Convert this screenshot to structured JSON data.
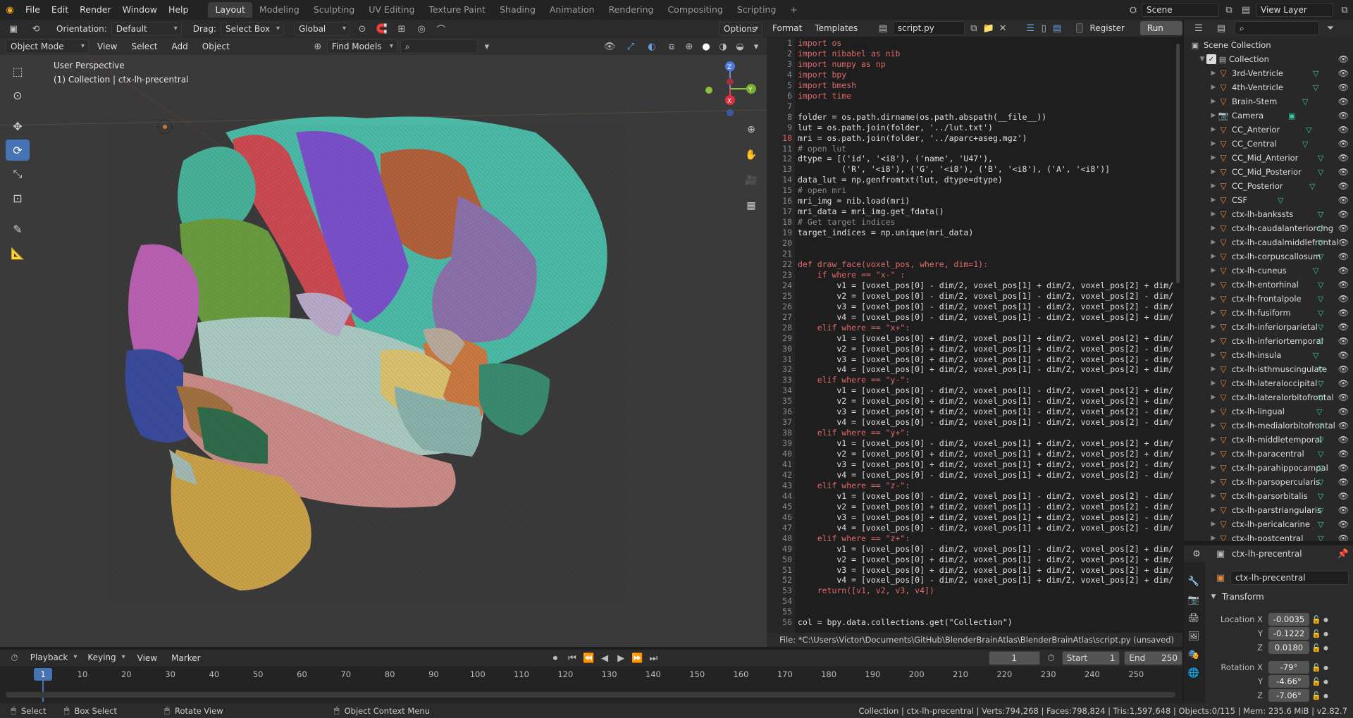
{
  "topbar": {
    "menus": [
      "File",
      "Edit",
      "Render",
      "Window",
      "Help"
    ],
    "workspaces": [
      "Layout",
      "Modeling",
      "Sculpting",
      "UV Editing",
      "Texture Paint",
      "Shading",
      "Animation",
      "Rendering",
      "Compositing",
      "Scripting"
    ],
    "active_workspace": "Layout",
    "scene": "Scene",
    "view_layer": "View Layer"
  },
  "viewport_header": {
    "orientation_label": "Orientation:",
    "orientation_value": "Default",
    "drag_label": "Drag:",
    "drag_value": "Select Box",
    "transform_space": "Global",
    "options": "Options"
  },
  "viewport_header2": {
    "mode": "Object Mode",
    "menus": [
      "View",
      "Select",
      "Add",
      "Object"
    ],
    "find_models": "Find Models"
  },
  "viewport": {
    "perspective": "User Perspective",
    "collection_info": "(1) Collection | ctx-lh-precentral",
    "gizmo_axes": [
      "Z",
      "Y",
      "X"
    ]
  },
  "editor_header": {
    "menus": [
      "Format",
      "Templates"
    ],
    "filename": "script.py",
    "register": "Register",
    "run": "Run Script"
  },
  "code_lines": [
    "import os",
    "import nibabel as nib",
    "import numpy as np",
    "import bpy",
    "import bmesh",
    "import time",
    "",
    "folder = os.path.dirname(os.path.abspath(__file__))",
    "lut = os.path.join(folder, '../lut.txt')",
    "mri = os.path.join(folder, '../aparc+aseg.mgz')",
    "# open lut",
    "dtype = [('id', '<i8'), ('name', 'U47'),",
    "         ('R', '<i8'), ('G', '<i8'), ('B', '<i8'), ('A', '<i8')]",
    "data_lut = np.genfromtxt(lut, dtype=dtype)",
    "# open mri",
    "mri_img = nib.load(mri)",
    "mri_data = mri_img.get_fdata()",
    "# Get target indices",
    "target_indices = np.unique(mri_data)",
    "",
    "",
    "def draw_face(voxel_pos, where, dim=1):",
    "    if where == \"x-\" :",
    "        v1 = [voxel_pos[0] - dim/2, voxel_pos[1] + dim/2, voxel_pos[2] + dim/",
    "        v2 = [voxel_pos[0] - dim/2, voxel_pos[1] - dim/2, voxel_pos[2] - dim/",
    "        v3 = [voxel_pos[0] - dim/2, voxel_pos[1] - dim/2, voxel_pos[2] - dim/",
    "        v4 = [voxel_pos[0] - dim/2, voxel_pos[1] - dim/2, voxel_pos[2] + dim/",
    "    elif where == \"x+\":",
    "        v1 = [voxel_pos[0] + dim/2, voxel_pos[1] + dim/2, voxel_pos[2] + dim/",
    "        v2 = [voxel_pos[0] + dim/2, voxel_pos[1] + dim/2, voxel_pos[2] - dim/",
    "        v3 = [voxel_pos[0] + dim/2, voxel_pos[1] - dim/2, voxel_pos[2] - dim/",
    "        v4 = [voxel_pos[0] + dim/2, voxel_pos[1] - dim/2, voxel_pos[2] + dim/",
    "    elif where == \"y-\":",
    "        v1 = [voxel_pos[0] - dim/2, voxel_pos[1] - dim/2, voxel_pos[2] + dim/",
    "        v2 = [voxel_pos[0] + dim/2, voxel_pos[1] - dim/2, voxel_pos[2] + dim/",
    "        v3 = [voxel_pos[0] + dim/2, voxel_pos[1] - dim/2, voxel_pos[2] - dim/",
    "        v4 = [voxel_pos[0] - dim/2, voxel_pos[1] - dim/2, voxel_pos[2] - dim/",
    "    elif where == \"y+\":",
    "        v1 = [voxel_pos[0] - dim/2, voxel_pos[1] + dim/2, voxel_pos[2] + dim/",
    "        v2 = [voxel_pos[0] + dim/2, voxel_pos[1] + dim/2, voxel_pos[2] + dim/",
    "        v3 = [voxel_pos[0] + dim/2, voxel_pos[1] + dim/2, voxel_pos[2] - dim/",
    "        v4 = [voxel_pos[0] - dim/2, voxel_pos[1] + dim/2, voxel_pos[2] - dim/",
    "    elif where == \"z-\":",
    "        v1 = [voxel_pos[0] - dim/2, voxel_pos[1] - dim/2, voxel_pos[2] - dim/",
    "        v2 = [voxel_pos[0] + dim/2, voxel_pos[1] - dim/2, voxel_pos[2] - dim/",
    "        v3 = [voxel_pos[0] + dim/2, voxel_pos[1] + dim/2, voxel_pos[2] - dim/",
    "        v4 = [voxel_pos[0] - dim/2, voxel_pos[1] + dim/2, voxel_pos[2] - dim/",
    "    elif where == \"z+\":",
    "        v1 = [voxel_pos[0] - dim/2, voxel_pos[1] - dim/2, voxel_pos[2] + dim/",
    "        v2 = [voxel_pos[0] + dim/2, voxel_pos[1] - dim/2, voxel_pos[2] + dim/",
    "        v3 = [voxel_pos[0] + dim/2, voxel_pos[1] + dim/2, voxel_pos[2] + dim/",
    "        v4 = [voxel_pos[0] - dim/2, voxel_pos[1] + dim/2, voxel_pos[2] + dim/",
    "    return([v1, v2, v3, v4])",
    "",
    "",
    "col = bpy.data.collections.get(\"Collection\")"
  ],
  "current_line": 10,
  "editor_footer": "File: *C:\\Users\\Victor\\Documents\\GitHub\\BlenderBrainAtlas\\BlenderBrainAtlas\\script.py (unsaved)",
  "outliner": {
    "root": "Scene Collection",
    "collection": "Collection",
    "items": [
      "3rd-Ventricle",
      "4th-Ventricle",
      "Brain-Stem",
      "Camera",
      "CC_Anterior",
      "CC_Central",
      "CC_Mid_Anterior",
      "CC_Mid_Posterior",
      "CC_Posterior",
      "CSF",
      "ctx-lh-bankssts",
      "ctx-lh-caudalanteriorcing",
      "ctx-lh-caudalmiddlefrontal",
      "ctx-lh-corpuscallosum",
      "ctx-lh-cuneus",
      "ctx-lh-entorhinal",
      "ctx-lh-frontalpole",
      "ctx-lh-fusiform",
      "ctx-lh-inferiorparietal",
      "ctx-lh-inferiortemporal",
      "ctx-lh-insula",
      "ctx-lh-isthmuscingulate",
      "ctx-lh-lateraloccipital",
      "ctx-lh-lateralorbitofrontal",
      "ctx-lh-lingual",
      "ctx-lh-medialorbitofrontal",
      "ctx-lh-middletemporal",
      "ctx-lh-paracentral",
      "ctx-lh-parahippocampal",
      "ctx-lh-parsopercularis",
      "ctx-lh-parsorbitalis",
      "ctx-lh-parstriangularis",
      "ctx-lh-pericalcarine",
      "ctx-lh-postcentral"
    ]
  },
  "properties": {
    "object": "ctx-lh-precentral",
    "object_name": "ctx-lh-precentral",
    "section": "Transform",
    "location_label": "Location X",
    "location": [
      "-0.0035",
      "-0.1222",
      "0.0180"
    ],
    "rotation_label": "Rotation X",
    "rotation": [
      "-79°",
      "-4.66°",
      "-7.06°"
    ],
    "axis_y": "Y",
    "axis_z": "Z"
  },
  "timeline": {
    "menus": [
      "Playback",
      "Keying",
      "View",
      "Marker"
    ],
    "current_frame": "1",
    "start_label": "Start",
    "start": "1",
    "end_label": "End",
    "end": "250",
    "ticks": [
      "10",
      "20",
      "30",
      "40",
      "50",
      "60",
      "70",
      "80",
      "90",
      "100",
      "110",
      "120",
      "130",
      "140",
      "150",
      "160",
      "170",
      "180",
      "190",
      "200",
      "210",
      "220",
      "230",
      "240",
      "250"
    ],
    "playhead": "1"
  },
  "statusbar": {
    "select": "Select",
    "box_select": "Box Select",
    "rotate_view": "Rotate View",
    "context_menu": "Object Context Menu",
    "stats": "Collection | ctx-lh-precentral | Verts:794,268 | Faces:798,824 | Tris:1,597,648 | Objects:0/115 | Mem: 235.6 MiB | v2.82.7"
  }
}
